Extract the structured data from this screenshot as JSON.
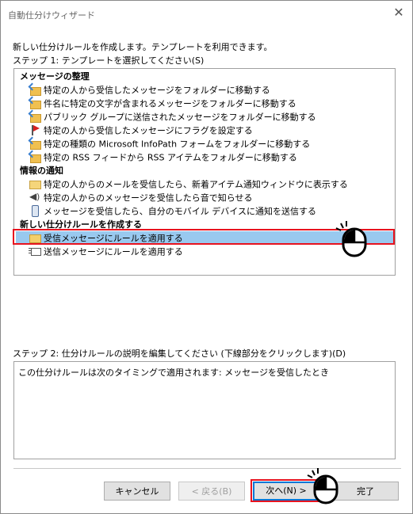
{
  "window": {
    "title": "自動仕分けウィザード",
    "close_glyph": "✕"
  },
  "intro": "新しい仕分けルールを作成します。テンプレートを利用できます。",
  "step1_label": "ステップ 1: テンプレートを選択してください(S)",
  "templates": {
    "group_organize": "メッセージの整理",
    "organize_items": [
      {
        "label": "特定の人から受信したメッセージをフォルダーに移動する",
        "icon": "folder-arrow-icon"
      },
      {
        "label": "件名に特定の文字が含まれるメッセージをフォルダーに移動する",
        "icon": "folder-arrow-icon"
      },
      {
        "label": "パブリック グループに送信されたメッセージをフォルダーに移動する",
        "icon": "folder-arrow-icon"
      },
      {
        "label": "特定の人から受信したメッセージにフラグを設定する",
        "icon": "flag-icon"
      },
      {
        "label": "特定の種類の Microsoft InfoPath フォームをフォルダーに移動する",
        "icon": "folder-arrow-icon"
      },
      {
        "label": "特定の RSS フィードから RSS アイテムをフォルダーに移動する",
        "icon": "folder-arrow-icon"
      }
    ],
    "group_notify": "情報の通知",
    "notify_items": [
      {
        "label": "特定の人からのメールを受信したら、新着アイテム通知ウィンドウに表示する",
        "icon": "mail-icon"
      },
      {
        "label": "特定の人からのメッセージを受信したら音で知らせる",
        "icon": "speaker-icon"
      },
      {
        "label": "メッセージを受信したら、自分のモバイル デバイスに通知を送信する",
        "icon": "phone-icon"
      }
    ],
    "group_blank": "新しい仕分けルールを作成する",
    "blank_items": [
      {
        "label": "受信メッセージにルールを適用する",
        "icon": "inbox-icon",
        "selected": true
      },
      {
        "label": "送信メッセージにルールを適用する",
        "icon": "outbox-icon",
        "selected": false
      }
    ]
  },
  "step2_label": "ステップ 2: 仕分けルールの説明を編集してください (下線部分をクリックします)(D)",
  "description": "この仕分けルールは次のタイミングで適用されます: メッセージを受信したとき",
  "buttons": {
    "cancel": "キャンセル",
    "back": "< 戻る(B)",
    "next": "次へ(N) >",
    "finish": "完了"
  },
  "colors": {
    "selection": "#99c9ef",
    "highlight": "#e8131f",
    "focus": "#0078d7"
  }
}
